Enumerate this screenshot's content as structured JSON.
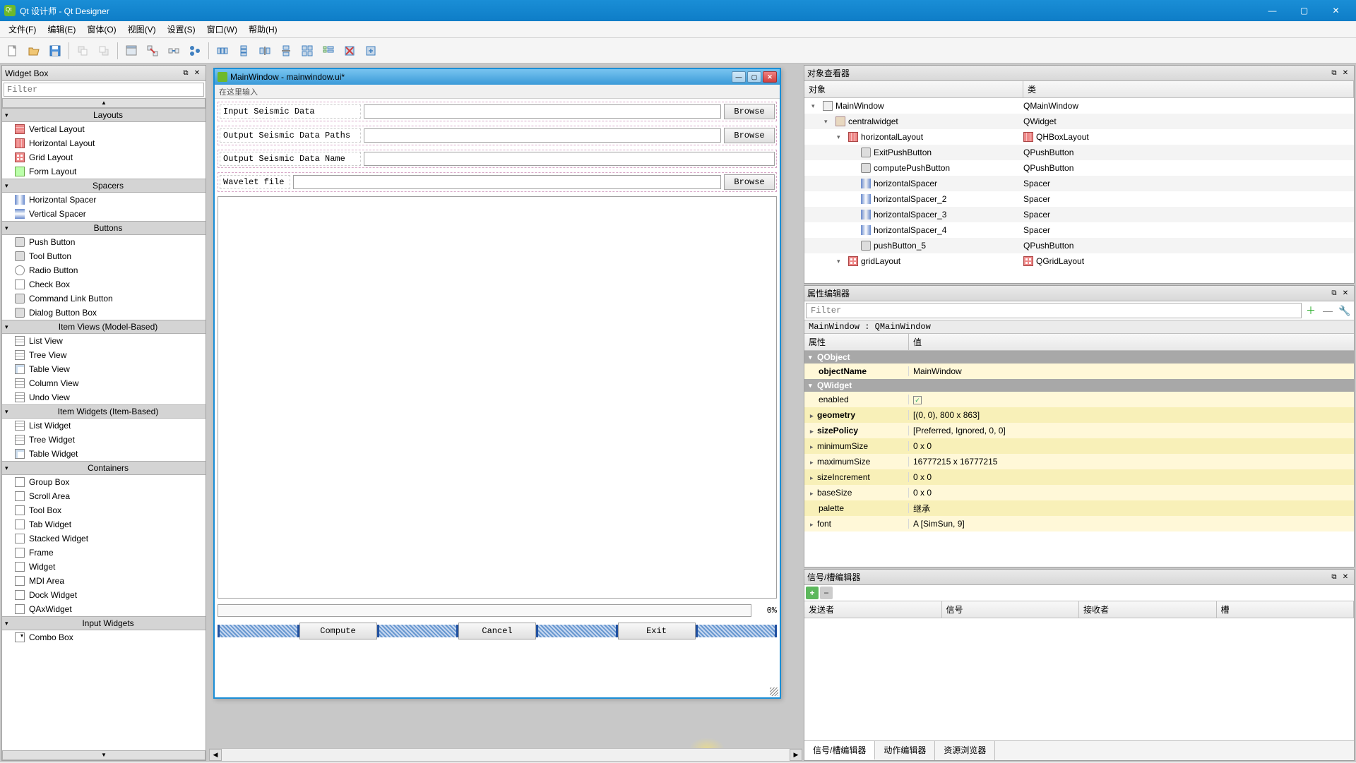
{
  "titlebar": {
    "text": "Qt 设计师 - Qt Designer"
  },
  "menubar": [
    "文件(F)",
    "编辑(E)",
    "窗体(O)",
    "视图(V)",
    "设置(S)",
    "窗口(W)",
    "帮助(H)"
  ],
  "widgetbox": {
    "title": "Widget Box",
    "filter_placeholder": "Filter",
    "categories": [
      {
        "name": "Layouts",
        "items": [
          {
            "label": "Vertical Layout",
            "ic": "ic-vlayout"
          },
          {
            "label": "Horizontal Layout",
            "ic": "ic-hlayout"
          },
          {
            "label": "Grid Layout",
            "ic": "ic-grid"
          },
          {
            "label": "Form Layout",
            "ic": "ic-form"
          }
        ]
      },
      {
        "name": "Spacers",
        "items": [
          {
            "label": "Horizontal Spacer",
            "ic": "ic-hspacer"
          },
          {
            "label": "Vertical Spacer",
            "ic": "ic-vspacer"
          }
        ]
      },
      {
        "name": "Buttons",
        "items": [
          {
            "label": "Push Button",
            "ic": "ic-button"
          },
          {
            "label": "Tool Button",
            "ic": "ic-button"
          },
          {
            "label": "Radio Button",
            "ic": "ic-radio"
          },
          {
            "label": "Check Box",
            "ic": "ic-check"
          },
          {
            "label": "Command Link Button",
            "ic": "ic-button"
          },
          {
            "label": "Dialog Button Box",
            "ic": "ic-button"
          }
        ]
      },
      {
        "name": "Item Views (Model-Based)",
        "items": [
          {
            "label": "List View",
            "ic": "ic-list"
          },
          {
            "label": "Tree View",
            "ic": "ic-list"
          },
          {
            "label": "Table View",
            "ic": "ic-table"
          },
          {
            "label": "Column View",
            "ic": "ic-list"
          },
          {
            "label": "Undo View",
            "ic": "ic-list"
          }
        ]
      },
      {
        "name": "Item Widgets (Item-Based)",
        "items": [
          {
            "label": "List Widget",
            "ic": "ic-list"
          },
          {
            "label": "Tree Widget",
            "ic": "ic-list"
          },
          {
            "label": "Table Widget",
            "ic": "ic-table"
          }
        ]
      },
      {
        "name": "Containers",
        "items": [
          {
            "label": "Group Box",
            "ic": "ic-container"
          },
          {
            "label": "Scroll Area",
            "ic": "ic-container"
          },
          {
            "label": "Tool Box",
            "ic": "ic-container"
          },
          {
            "label": "Tab Widget",
            "ic": "ic-container"
          },
          {
            "label": "Stacked Widget",
            "ic": "ic-container"
          },
          {
            "label": "Frame",
            "ic": "ic-container"
          },
          {
            "label": "Widget",
            "ic": "ic-container"
          },
          {
            "label": "MDI Area",
            "ic": "ic-container"
          },
          {
            "label": "Dock Widget",
            "ic": "ic-container"
          },
          {
            "label": "QAxWidget",
            "ic": "ic-container"
          }
        ]
      },
      {
        "name": "Input Widgets",
        "items": [
          {
            "label": "Combo Box",
            "ic": "ic-combo"
          }
        ]
      }
    ]
  },
  "design": {
    "title": "MainWindow - mainwindow.ui*",
    "menu_hint": "在这里输入",
    "rows": [
      {
        "label": "Input Seismic Data",
        "browse": "Browse",
        "has_browse": true
      },
      {
        "label": "Output Seismic Data Paths",
        "browse": "Browse",
        "has_browse": true
      },
      {
        "label": "Output Seismic Data Name",
        "browse": "",
        "has_browse": false
      },
      {
        "label": "Wavelet file",
        "browse": "Browse",
        "has_browse": true
      }
    ],
    "progress_pct": "0%",
    "buttons": [
      "Compute",
      "Cancel",
      "Exit"
    ]
  },
  "objinspector": {
    "title": "对象查看器",
    "headers": [
      "对象",
      "类"
    ],
    "rows": [
      {
        "indent": 0,
        "exp": "▾",
        "name": "MainWindow",
        "cls": "QMainWindow",
        "ic": "ic-window"
      },
      {
        "indent": 1,
        "exp": "▾",
        "name": "centralwidget",
        "cls": "QWidget",
        "ic": "ic-widget"
      },
      {
        "indent": 2,
        "exp": "▾",
        "name": "horizontalLayout",
        "cls": "QHBoxLayout",
        "ic": "ic-hlayout",
        "clsic": "ic-hlayout"
      },
      {
        "indent": 3,
        "exp": "",
        "name": "ExitPushButton",
        "cls": "QPushButton",
        "ic": "ic-button"
      },
      {
        "indent": 3,
        "exp": "",
        "name": "computePushButton",
        "cls": "QPushButton",
        "ic": "ic-button"
      },
      {
        "indent": 3,
        "exp": "",
        "name": "horizontalSpacer",
        "cls": "Spacer",
        "ic": "ic-spacer"
      },
      {
        "indent": 3,
        "exp": "",
        "name": "horizontalSpacer_2",
        "cls": "Spacer",
        "ic": "ic-spacer"
      },
      {
        "indent": 3,
        "exp": "",
        "name": "horizontalSpacer_3",
        "cls": "Spacer",
        "ic": "ic-spacer"
      },
      {
        "indent": 3,
        "exp": "",
        "name": "horizontalSpacer_4",
        "cls": "Spacer",
        "ic": "ic-spacer"
      },
      {
        "indent": 3,
        "exp": "",
        "name": "pushButton_5",
        "cls": "QPushButton",
        "ic": "ic-button"
      },
      {
        "indent": 2,
        "exp": "▾",
        "name": "gridLayout",
        "cls": "QGridLayout",
        "ic": "ic-grid",
        "clsic": "ic-grid"
      }
    ]
  },
  "propeditor": {
    "title": "属性编辑器",
    "filter_placeholder": "Filter",
    "class_line": "MainWindow : QMainWindow",
    "headers": [
      "属性",
      "值"
    ],
    "groups": [
      {
        "group": "QObject",
        "bg": "#a8a8a8"
      },
      {
        "name": "objectName",
        "val": "MainWindow",
        "bold": true,
        "cls": "yellow"
      },
      {
        "group": "QWidget",
        "bg": "#a8a8a8"
      },
      {
        "name": "enabled",
        "val": "",
        "check": true,
        "cls": "yellow"
      },
      {
        "name": "geometry",
        "val": "[(0, 0), 800 x 863]",
        "exp": "▸",
        "bold": true,
        "cls": "yellow2"
      },
      {
        "name": "sizePolicy",
        "val": "[Preferred, Ignored, 0, 0]",
        "exp": "▸",
        "bold": true,
        "cls": "yellow"
      },
      {
        "name": "minimumSize",
        "val": "0 x 0",
        "exp": "▸",
        "cls": "yellow2"
      },
      {
        "name": "maximumSize",
        "val": "16777215 x 16777215",
        "exp": "▸",
        "cls": "yellow"
      },
      {
        "name": "sizeIncrement",
        "val": "0 x 0",
        "exp": "▸",
        "cls": "yellow2"
      },
      {
        "name": "baseSize",
        "val": "0 x 0",
        "exp": "▸",
        "cls": "yellow"
      },
      {
        "name": "palette",
        "val": "继承",
        "cls": "yellow2"
      },
      {
        "name": "font",
        "val": "A  [SimSun, 9]",
        "exp": "▸",
        "cls": "yellow"
      }
    ]
  },
  "sigeditor": {
    "title": "信号/槽编辑器",
    "headers": [
      "发送者",
      "信号",
      "接收者",
      "槽"
    ]
  },
  "bottomtabs": [
    "信号/槽编辑器",
    "动作编辑器",
    "资源浏览器"
  ]
}
